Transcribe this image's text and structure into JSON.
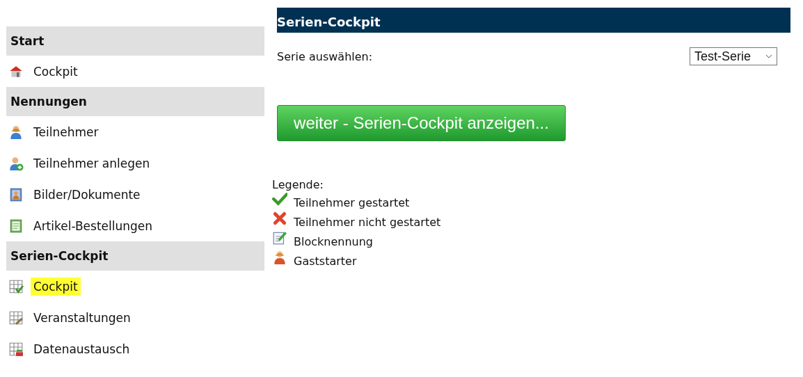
{
  "sidebar": {
    "sections": [
      {
        "title": "Start",
        "items": [
          {
            "label": "Cockpit",
            "kind": "house",
            "selected": false
          }
        ]
      },
      {
        "title": "Nennungen",
        "items": [
          {
            "label": "Teilnehmer",
            "kind": "person",
            "selected": false
          },
          {
            "label": "Teilnehmer anlegen",
            "kind": "person-add",
            "selected": false
          },
          {
            "label": "Bilder/Dokumente",
            "kind": "photo",
            "selected": false
          },
          {
            "label": "Artikel-Bestellungen",
            "kind": "list",
            "selected": false
          }
        ]
      },
      {
        "title": "Serien-Cockpit",
        "items": [
          {
            "label": "Cockpit",
            "kind": "grid-check",
            "selected": true
          },
          {
            "label": "Veranstaltungen",
            "kind": "grid-edit",
            "selected": false
          },
          {
            "label": "Datenaustausch",
            "kind": "grid-exchange",
            "selected": false
          }
        ]
      }
    ]
  },
  "main": {
    "title": "Serien-Cockpit",
    "series_label": "Serie auswählen:",
    "series_value": "Test-Serie",
    "button": "weiter - Serien-Cockpit anzeigen...",
    "legend": {
      "title": "Legende:",
      "items": [
        {
          "label": "Teilnehmer gestartet",
          "kind": "check"
        },
        {
          "label": "Teilnehmer nicht gestartet",
          "kind": "cross"
        },
        {
          "label": "Blocknennung",
          "kind": "edit"
        },
        {
          "label": "Gaststarter",
          "kind": "guest"
        }
      ]
    }
  }
}
